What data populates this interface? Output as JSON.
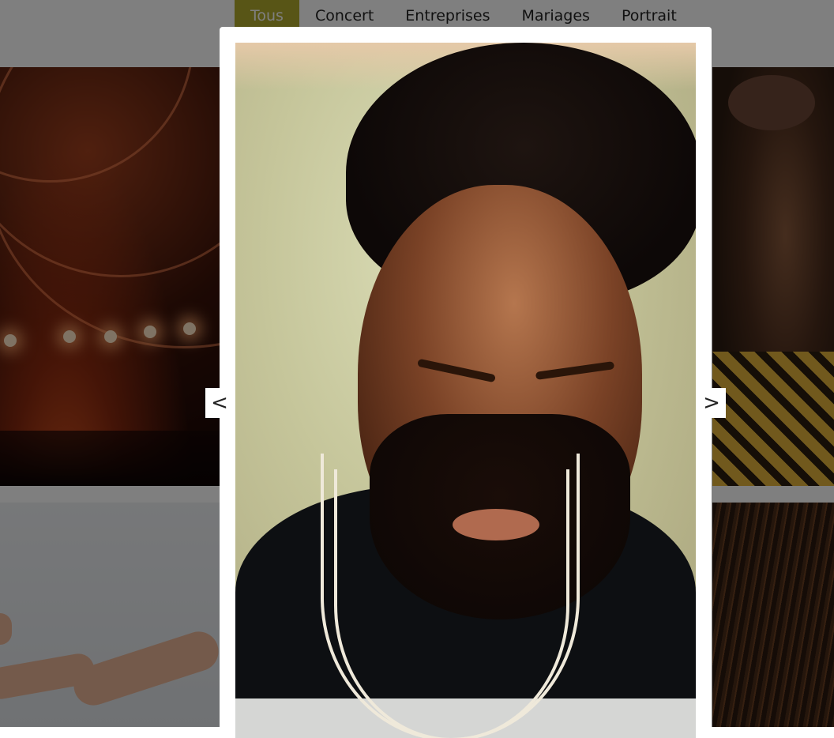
{
  "filters": {
    "items": [
      {
        "label": "Tous",
        "active": true
      },
      {
        "label": "Concert",
        "active": false
      },
      {
        "label": "Entreprises",
        "active": false
      },
      {
        "label": "Mariages",
        "active": false
      },
      {
        "label": "Portrait",
        "active": false
      }
    ]
  },
  "colors": {
    "active_filter": "#b0aa2c",
    "overlay": "rgba(0,0,0,0.5)"
  },
  "gallery": {
    "tiles": [
      "concert",
      "portrait",
      "wedding",
      "portrait"
    ]
  },
  "modal": {
    "prev_label": "<",
    "next_label": ">",
    "image_subject": "portrait"
  }
}
